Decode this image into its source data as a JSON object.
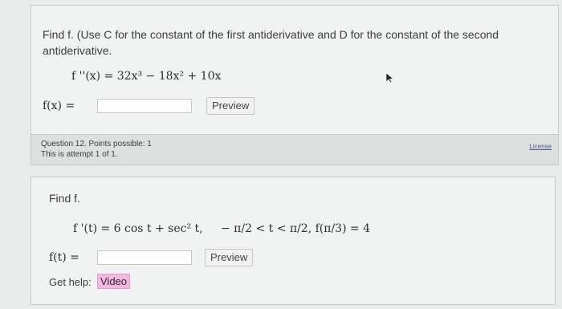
{
  "question1": {
    "prompt": "Find f. (Use C for the constant of the first antiderivative and D for the constant of the second antiderivative.",
    "given_equation": "f ''(x) = 32x³ − 18x² + 10x",
    "answer_label": "f(x) =",
    "answer_value": "",
    "preview_label": "Preview"
  },
  "question1_footer": {
    "question_info": "Question 12. Points possible: 1",
    "attempt_info": "This is attempt 1 of 1.",
    "license_label": "License"
  },
  "question2": {
    "prompt": "Find f.",
    "given_equation": "f '(t) = 6 cos t + sec² t,",
    "condition": "− π/2 < t < π/2,   f(π/3) = 4",
    "answer_label": "f(t) =",
    "answer_value": "",
    "preview_label": "Preview",
    "help_label": "Get help:",
    "video_label": "Video"
  },
  "icons": {
    "cursor": "mouse-pointer-icon"
  }
}
